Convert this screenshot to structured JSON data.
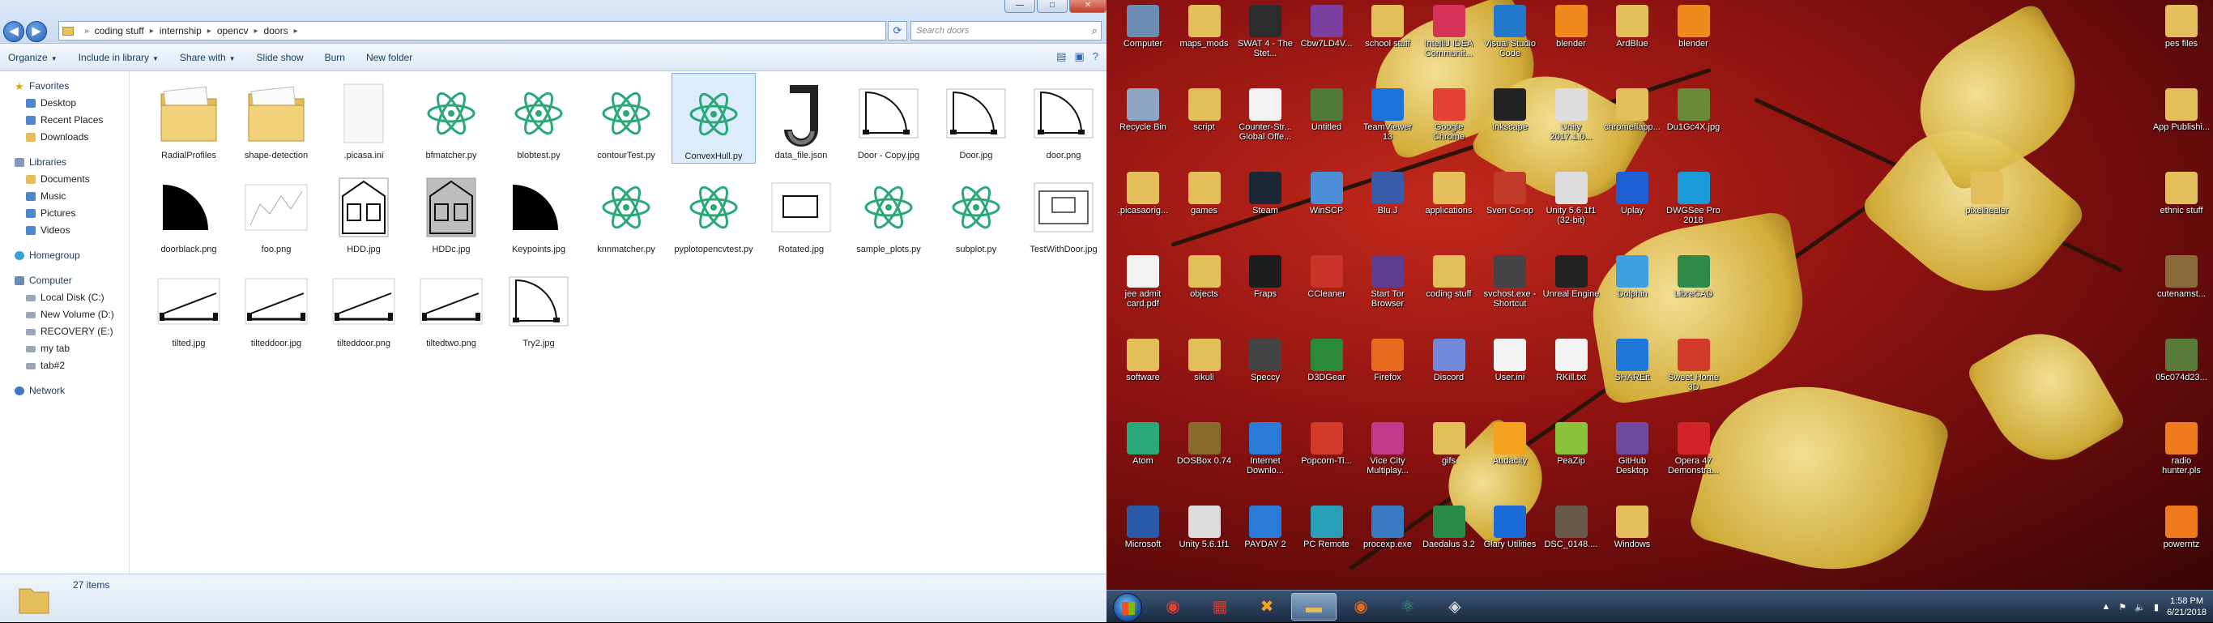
{
  "explorer": {
    "path": [
      "coding stuff",
      "internship",
      "opencv",
      "doors"
    ],
    "search_placeholder": "Search doors",
    "toolbar": [
      "Organize",
      "Include in library",
      "Share with",
      "Slide show",
      "Burn",
      "New folder"
    ],
    "sidebar": [
      {
        "label": "Favorites",
        "level": 0,
        "icon": "star-icon"
      },
      {
        "label": "Desktop",
        "level": 1,
        "icon": "desktop-icon"
      },
      {
        "label": "Recent Places",
        "level": 1,
        "icon": "recent-places-icon"
      },
      {
        "label": "Downloads",
        "level": 1,
        "icon": "downloads-icon"
      },
      {
        "label": "Libraries",
        "level": 0,
        "icon": "library-icon"
      },
      {
        "label": "Documents",
        "level": 1,
        "icon": "documents-icon"
      },
      {
        "label": "Music",
        "level": 1,
        "icon": "music-icon"
      },
      {
        "label": "Pictures",
        "level": 1,
        "icon": "pictures-icon"
      },
      {
        "label": "Videos",
        "level": 1,
        "icon": "videos-icon"
      },
      {
        "label": "Homegroup",
        "level": 0,
        "icon": "homegroup-icon"
      },
      {
        "label": "Computer",
        "level": 0,
        "icon": "computer-icon"
      },
      {
        "label": "Local Disk (C:)",
        "level": 1,
        "icon": "drive-icon"
      },
      {
        "label": "New Volume (D:)",
        "level": 1,
        "icon": "drive-icon"
      },
      {
        "label": "RECOVERY (E:)",
        "level": 1,
        "icon": "drive-icon"
      },
      {
        "label": "my tab",
        "level": 1,
        "icon": "drive-icon"
      },
      {
        "label": "tab#2",
        "level": 1,
        "icon": "drive-icon"
      },
      {
        "label": "Network",
        "level": 0,
        "icon": "network-icon"
      }
    ],
    "files": [
      {
        "name": "RadialProfiles",
        "type": "folder"
      },
      {
        "name": "shape-detection",
        "type": "folder"
      },
      {
        "name": ".picasa.ini",
        "type": "text"
      },
      {
        "name": "bfmatcher.py",
        "type": "atom"
      },
      {
        "name": "blobtest.py",
        "type": "atom"
      },
      {
        "name": "contourTest.py",
        "type": "atom"
      },
      {
        "name": "ConvexHull.py",
        "type": "atom",
        "selected": true
      },
      {
        "name": "data_file.json",
        "type": "json"
      },
      {
        "name": "Door - Copy.jpg",
        "type": "door"
      },
      {
        "name": "Door.jpg",
        "type": "door"
      },
      {
        "name": "door.png",
        "type": "door"
      },
      {
        "name": "doorblack.png",
        "type": "blackdoor"
      },
      {
        "name": "foo.png",
        "type": "plot"
      },
      {
        "name": "HDD.jpg",
        "type": "house"
      },
      {
        "name": "HDDc.jpg",
        "type": "housegray"
      },
      {
        "name": "Keypoints.jpg",
        "type": "blackdoor"
      },
      {
        "name": "knnmatcher.py",
        "type": "atom"
      },
      {
        "name": "pyplotopencvtest.py",
        "type": "atom"
      },
      {
        "name": "Rotated.jpg",
        "type": "rect"
      },
      {
        "name": "sample_plots.py",
        "type": "atom"
      },
      {
        "name": "subplot.py",
        "type": "atom"
      },
      {
        "name": "TestWithDoor.jpg",
        "type": "rect2"
      },
      {
        "name": "tilted.jpg",
        "type": "tilted"
      },
      {
        "name": "tiltеddoor.jpg",
        "type": "tilted"
      },
      {
        "name": "tilteddoor.png",
        "type": "tilted"
      },
      {
        "name": "tiltedtwo.png",
        "type": "tilted"
      },
      {
        "name": "Try2.jpg",
        "type": "door"
      }
    ],
    "status": "27 items"
  },
  "desktop": {
    "icons": [
      {
        "label": "Computer",
        "col": 0,
        "row": 0,
        "color": "#6d8cb4"
      },
      {
        "label": "maps_mods",
        "col": 1,
        "row": 0,
        "color": "#e3be5a"
      },
      {
        "label": "SWAT 4 - The Stet...",
        "col": 2,
        "row": 0,
        "color": "#2c2c2c"
      },
      {
        "label": "Cbw7LD4V...",
        "col": 3,
        "row": 0,
        "color": "#7a3fa0"
      },
      {
        "label": "school stuff",
        "col": 4,
        "row": 0,
        "color": "#e3be5a"
      },
      {
        "label": "IntelliJ IDEA Communit...",
        "col": 5,
        "row": 0,
        "color": "#d7325a"
      },
      {
        "label": "Visual Studio Code",
        "col": 6,
        "row": 0,
        "color": "#2478cc"
      },
      {
        "label": "blender",
        "col": 7,
        "row": 0,
        "color": "#f08a1d"
      },
      {
        "label": "ArdBlue",
        "col": 8,
        "row": 0,
        "color": "#e3be5a"
      },
      {
        "label": "blender",
        "col": 9,
        "row": 0,
        "color": "#f08a1d"
      },
      {
        "label": "Recycle Bin",
        "col": 0,
        "row": 1,
        "color": "#8fa6c2"
      },
      {
        "label": "script",
        "col": 1,
        "row": 1,
        "color": "#e3be5a"
      },
      {
        "label": "Counter-Str... Global Offe...",
        "col": 2,
        "row": 1,
        "color": "#f2f2f2"
      },
      {
        "label": "Untitled",
        "col": 3,
        "row": 1,
        "color": "#4f7a3a"
      },
      {
        "label": "TeamViewer 13",
        "col": 4,
        "row": 1,
        "color": "#1c72d8"
      },
      {
        "label": "Google Chrome",
        "col": 5,
        "row": 1,
        "color": "#e34133"
      },
      {
        "label": "Inkscape",
        "col": 6,
        "row": 1,
        "color": "#222222"
      },
      {
        "label": "Unity 2017.1.0...",
        "col": 7,
        "row": 1,
        "color": "#dddddd"
      },
      {
        "label": "chromeflapp...",
        "col": 8,
        "row": 1,
        "color": "#e3be5a"
      },
      {
        "label": "Du1Gc4X.jpg",
        "col": 9,
        "row": 1,
        "color": "#6a8a3a"
      },
      {
        "label": ".picasaorig...",
        "col": 0,
        "row": 2,
        "color": "#e3be5a"
      },
      {
        "label": "games",
        "col": 1,
        "row": 2,
        "color": "#e3be5a"
      },
      {
        "label": "Steam",
        "col": 2,
        "row": 2,
        "color": "#1b2838"
      },
      {
        "label": "WinSCP",
        "col": 3,
        "row": 2,
        "color": "#4d8fd6"
      },
      {
        "label": "Blu.J",
        "col": 4,
        "row": 2,
        "color": "#3a5ca8"
      },
      {
        "label": "applications",
        "col": 5,
        "row": 2,
        "color": "#e3be5a"
      },
      {
        "label": "Sven Co-op",
        "col": 6,
        "row": 2,
        "color": "#c23a2a"
      },
      {
        "label": "Unity 5.6.1f1 (32-bit)",
        "col": 7,
        "row": 2,
        "color": "#dddddd"
      },
      {
        "label": "Uplay",
        "col": 8,
        "row": 2,
        "color": "#1f5fd6"
      },
      {
        "label": "DWGSee Pro 2018",
        "col": 9,
        "row": 2,
        "color": "#1a9ad8"
      },
      {
        "label": "jee admit card.pdf",
        "col": 0,
        "row": 3,
        "color": "#f2f2f2"
      },
      {
        "label": "objects",
        "col": 1,
        "row": 3,
        "color": "#e3be5a"
      },
      {
        "label": "Fraps",
        "col": 2,
        "row": 3,
        "color": "#1d1d1d"
      },
      {
        "label": "CCleaner",
        "col": 3,
        "row": 3,
        "color": "#c9332a"
      },
      {
        "label": "Start Tor Browser",
        "col": 4,
        "row": 3,
        "color": "#5e3d8f"
      },
      {
        "label": "coding stuff",
        "col": 5,
        "row": 3,
        "color": "#e3be5a"
      },
      {
        "label": "svchost.exe - Shortcut",
        "col": 6,
        "row": 3,
        "color": "#444444"
      },
      {
        "label": "Unreal Engine",
        "col": 7,
        "row": 3,
        "color": "#222222"
      },
      {
        "label": "Dolphin",
        "col": 8,
        "row": 3,
        "color": "#3fa0e0"
      },
      {
        "label": "LibreCAD",
        "col": 9,
        "row": 3,
        "color": "#2f8a4a"
      },
      {
        "label": "software",
        "col": 0,
        "row": 4,
        "color": "#e3be5a"
      },
      {
        "label": "sikuli",
        "col": 1,
        "row": 4,
        "color": "#e3be5a"
      },
      {
        "label": "Speccy",
        "col": 2,
        "row": 4,
        "color": "#444444"
      },
      {
        "label": "D3DGear",
        "col": 3,
        "row": 4,
        "color": "#2a8a3a"
      },
      {
        "label": "Firefox",
        "col": 4,
        "row": 4,
        "color": "#e76a1e"
      },
      {
        "label": "Discord",
        "col": 5,
        "row": 4,
        "color": "#7289da"
      },
      {
        "label": "User.ini",
        "col": 6,
        "row": 4,
        "color": "#f2f2f2"
      },
      {
        "label": "RKill.txt",
        "col": 7,
        "row": 4,
        "color": "#f2f2f2"
      },
      {
        "label": "SHAREit",
        "col": 8,
        "row": 4,
        "color": "#1e78d8"
      },
      {
        "label": "Sweet Home 3D",
        "col": 9,
        "row": 4,
        "color": "#d23a2a"
      },
      {
        "label": "Atom",
        "col": 0,
        "row": 5,
        "color": "#2aa877"
      },
      {
        "label": "DOSBox 0.74",
        "col": 1,
        "row": 5,
        "color": "#8a6a2a"
      },
      {
        "label": "Internet Downlo...",
        "col": 2,
        "row": 5,
        "color": "#2a7ad8"
      },
      {
        "label": "Popcorn-Ti...",
        "col": 3,
        "row": 5,
        "color": "#d23a2a"
      },
      {
        "label": "Vice City Multiplay...",
        "col": 4,
        "row": 5,
        "color": "#c23a8a"
      },
      {
        "label": "gifs",
        "col": 5,
        "row": 5,
        "color": "#e3be5a"
      },
      {
        "label": "Audacity",
        "col": 6,
        "row": 5,
        "color": "#f2a21e"
      },
      {
        "label": "PeaZip",
        "col": 7,
        "row": 5,
        "color": "#8ac23a"
      },
      {
        "label": "GitHub Desktop",
        "col": 8,
        "row": 5,
        "color": "#6e4a9e"
      },
      {
        "label": "Opera 47 Demonstra...",
        "col": 9,
        "row": 5,
        "color": "#d2232a"
      },
      {
        "label": "Microsoft",
        "col": 0,
        "row": 6,
        "color": "#2a5aa8"
      },
      {
        "label": "Unity 5.6.1f1",
        "col": 1,
        "row": 6,
        "color": "#dddddd"
      },
      {
        "label": "PAYDAY 2",
        "col": 2,
        "row": 6,
        "color": "#2a7ad8"
      },
      {
        "label": "PC Remote",
        "col": 3,
        "row": 6,
        "color": "#2aa0b8"
      },
      {
        "label": "procexp.exe",
        "col": 4,
        "row": 6,
        "color": "#3a7ac2"
      },
      {
        "label": "Daedalus 3.2",
        "col": 5,
        "row": 6,
        "color": "#2a8a4a"
      },
      {
        "label": "Glary Utilities",
        "col": 6,
        "row": 6,
        "color": "#1a6ad8"
      },
      {
        "label": "DSC_0148....",
        "col": 7,
        "row": 6,
        "color": "#6a5a4a"
      },
      {
        "label": "Windows",
        "col": 8,
        "row": 6,
        "color": "#e3be5a"
      },
      {
        "label": "pes files",
        "col": 10,
        "row": 0,
        "color": "#e3be5a"
      },
      {
        "label": "App Publishi...",
        "col": 10,
        "row": 1,
        "color": "#e3be5a"
      },
      {
        "label": "pixelhealer",
        "col": 11,
        "row": 2,
        "color": "#e3be5a"
      },
      {
        "label": "ethnic stuff",
        "col": 10,
        "row": 2,
        "color": "#e3be5a"
      },
      {
        "label": "cutenamst...",
        "col": 10,
        "row": 3,
        "color": "#8a6a3a"
      },
      {
        "label": "05c074d23...",
        "col": 10,
        "row": 4,
        "color": "#5a7a3a"
      },
      {
        "label": "radio hunter.pls",
        "col": 10,
        "row": 5,
        "color": "#f07a1e"
      },
      {
        "label": "powerntz",
        "col": 10,
        "row": 6,
        "color": "#f07a1e"
      }
    ]
  },
  "taskbar": {
    "apps": [
      {
        "icon": "chrome-icon",
        "glyph": "◉",
        "color": "#e34133"
      },
      {
        "icon": "app-icon",
        "glyph": "▦",
        "color": "#d23a2a"
      },
      {
        "icon": "tool-icon",
        "glyph": "✖",
        "color": "#f2a21e"
      },
      {
        "icon": "explorer-icon",
        "glyph": "▬",
        "color": "#e3be5a",
        "active": true
      },
      {
        "icon": "firefox-icon",
        "glyph": "◉",
        "color": "#e76a1e"
      },
      {
        "icon": "atom-icon",
        "glyph": "⚛",
        "color": "#2aa877"
      },
      {
        "icon": "unity-icon",
        "glyph": "◈",
        "color": "#dddddd"
      }
    ],
    "time": "1:58 PM",
    "date": "6/21/2018"
  }
}
